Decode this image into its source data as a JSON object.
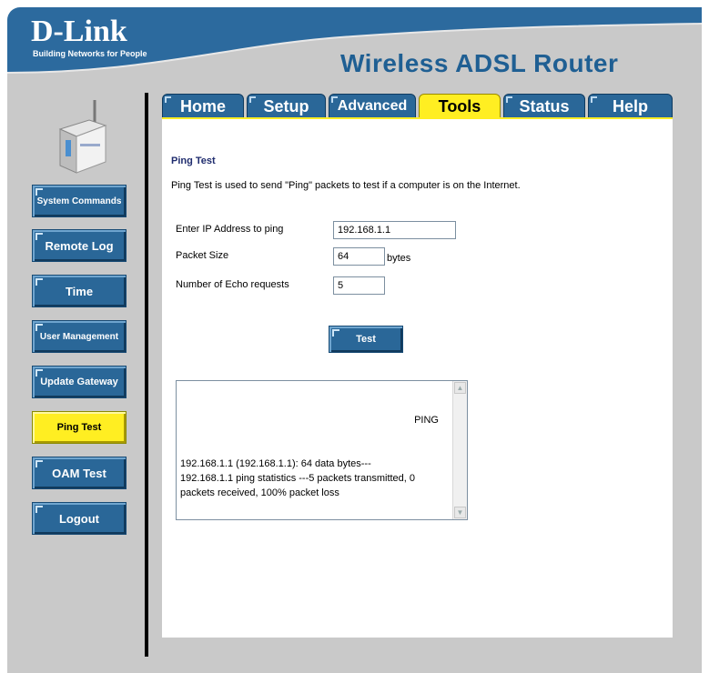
{
  "header": {
    "logo": "D-Link",
    "logo_tagline": "Building Networks for People",
    "product": "Wireless ADSL Router"
  },
  "tabs": [
    {
      "label": "Home",
      "active": false
    },
    {
      "label": "Setup",
      "active": false
    },
    {
      "label": "Advanced",
      "active": false
    },
    {
      "label": "Tools",
      "active": true
    },
    {
      "label": "Status",
      "active": false
    },
    {
      "label": "Help",
      "active": false
    }
  ],
  "sidebar": {
    "items": [
      {
        "label": "System Commands",
        "active": false
      },
      {
        "label": "Remote Log",
        "active": false
      },
      {
        "label": "Time",
        "active": false
      },
      {
        "label": "User Management",
        "active": false
      },
      {
        "label": "Update Gateway",
        "active": false
      },
      {
        "label": "Ping Test",
        "active": true
      },
      {
        "label": "OAM Test",
        "active": false
      },
      {
        "label": "Logout",
        "active": false
      }
    ]
  },
  "main": {
    "title": "Ping Test",
    "description": "Ping Test is used to send \"Ping\" packets to test if a computer is on the Internet.",
    "ip_label": "Enter IP Address to ping",
    "ip_value": "192.168.1.1",
    "size_label": "Packet Size",
    "size_value": "64",
    "size_unit": "bytes",
    "echo_label": "Number of Echo requests",
    "echo_value": "5",
    "test_button": "Test",
    "result_line1": "PING",
    "result_body": "192.168.1.1 (192.168.1.1): 64 data bytes---\n192.168.1.1 ping statistics ---5 packets transmitted, 0 packets received, 100% packet loss"
  },
  "colors": {
    "brand_blue": "#2a6798",
    "active_yellow": "#ffee22",
    "sidebar_bg": "#c9c9c9"
  }
}
